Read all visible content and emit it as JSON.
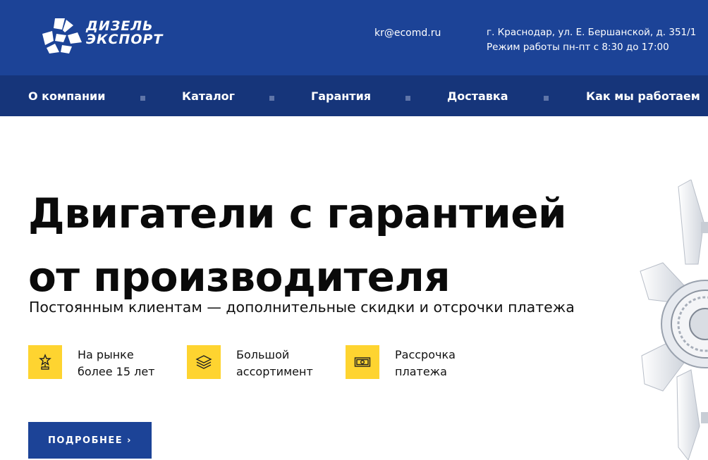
{
  "header": {
    "logo": {
      "line1": "ДИЗЕЛЬ",
      "line2": "ЭКСПОРТ",
      "icon": "logo-icon"
    },
    "email": "kr@ecomd.ru",
    "address": "г. Краснодар, ул. Е. Бершанской, д. 351/1",
    "hours": "Режим работы пн-пт с 8:30 до 17:00",
    "bg_color": "#1c4397"
  },
  "nav": {
    "bg_color": "#16357a",
    "items": [
      {
        "label": "О компании"
      },
      {
        "label": "Каталог"
      },
      {
        "label": "Гарантия"
      },
      {
        "label": "Доставка"
      },
      {
        "label": "Как мы работаем"
      }
    ]
  },
  "hero": {
    "title_line1": "Двигатели с гарантией",
    "title_line2": "от производителя",
    "subtitle": "Постоянным клиентам — дополнительные скидки и отсрочки платежа",
    "features": [
      {
        "icon": "award-icon",
        "line1": "На рынке",
        "line2": "более 15 лет"
      },
      {
        "icon": "layers-icon",
        "line1": "Большой",
        "line2": "ассортимент"
      },
      {
        "icon": "money-icon",
        "line1": "Рассрочка",
        "line2": "платежа"
      }
    ],
    "accent_color": "#fed430",
    "button_label": "ПОДРОБНЕЕ ›",
    "image": "engine-fan-image"
  }
}
